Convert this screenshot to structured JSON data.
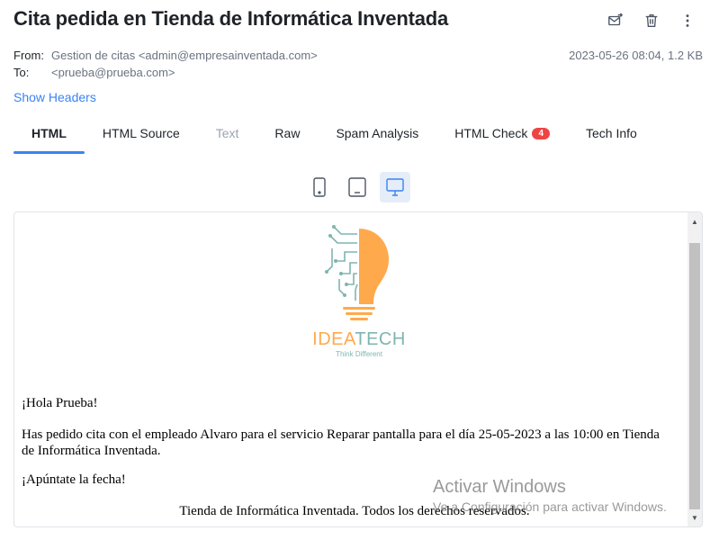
{
  "email": {
    "subject": "Cita pedida en Tienda de Informática Inventada",
    "from_label": "From:",
    "from_value": "Gestion de citas <admin@empresainventada.com>",
    "to_label": "To:",
    "to_value": "<prueba@prueba.com>",
    "date_size": "2023-05-26 08:04, 1.2 KB",
    "show_headers": "Show Headers"
  },
  "toolbar": {
    "icons": [
      "forward-mail-icon",
      "trash-icon",
      "more-vertical-icon"
    ]
  },
  "tabs": [
    {
      "label": "HTML",
      "state": "active"
    },
    {
      "label": "HTML Source",
      "state": "normal"
    },
    {
      "label": "Text",
      "state": "disabled"
    },
    {
      "label": "Raw",
      "state": "normal"
    },
    {
      "label": "Spam Analysis",
      "state": "normal"
    },
    {
      "label": "HTML Check",
      "state": "normal",
      "badge": "4"
    },
    {
      "label": "Tech Info",
      "state": "normal"
    }
  ],
  "devices": [
    {
      "name": "phone",
      "active": false
    },
    {
      "name": "tablet",
      "active": false
    },
    {
      "name": "desktop",
      "active": true
    }
  ],
  "body": {
    "logo_text_1": "IDEA",
    "logo_text_2": "TECH",
    "logo_tagline": "Think Different",
    "greeting": "¡Hola Prueba!",
    "paragraph": "Has pedido cita con el empleado Alvaro para el servicio Reparar pantalla para el día 25-05-2023 a las 10:00 en Tienda de Informática Inventada.",
    "reminder": "¡Apúntate la fecha!",
    "footer": "Tienda de Informática Inventada. Todos los derechos reservados."
  },
  "watermark": {
    "line1": "Activar Windows",
    "line2": "Ve a Configuración para activar Windows."
  },
  "colors": {
    "accent": "#3b82f6",
    "badge": "#ef4444",
    "logo_orange": "#ffa94d",
    "logo_teal": "#7fb5b0"
  }
}
